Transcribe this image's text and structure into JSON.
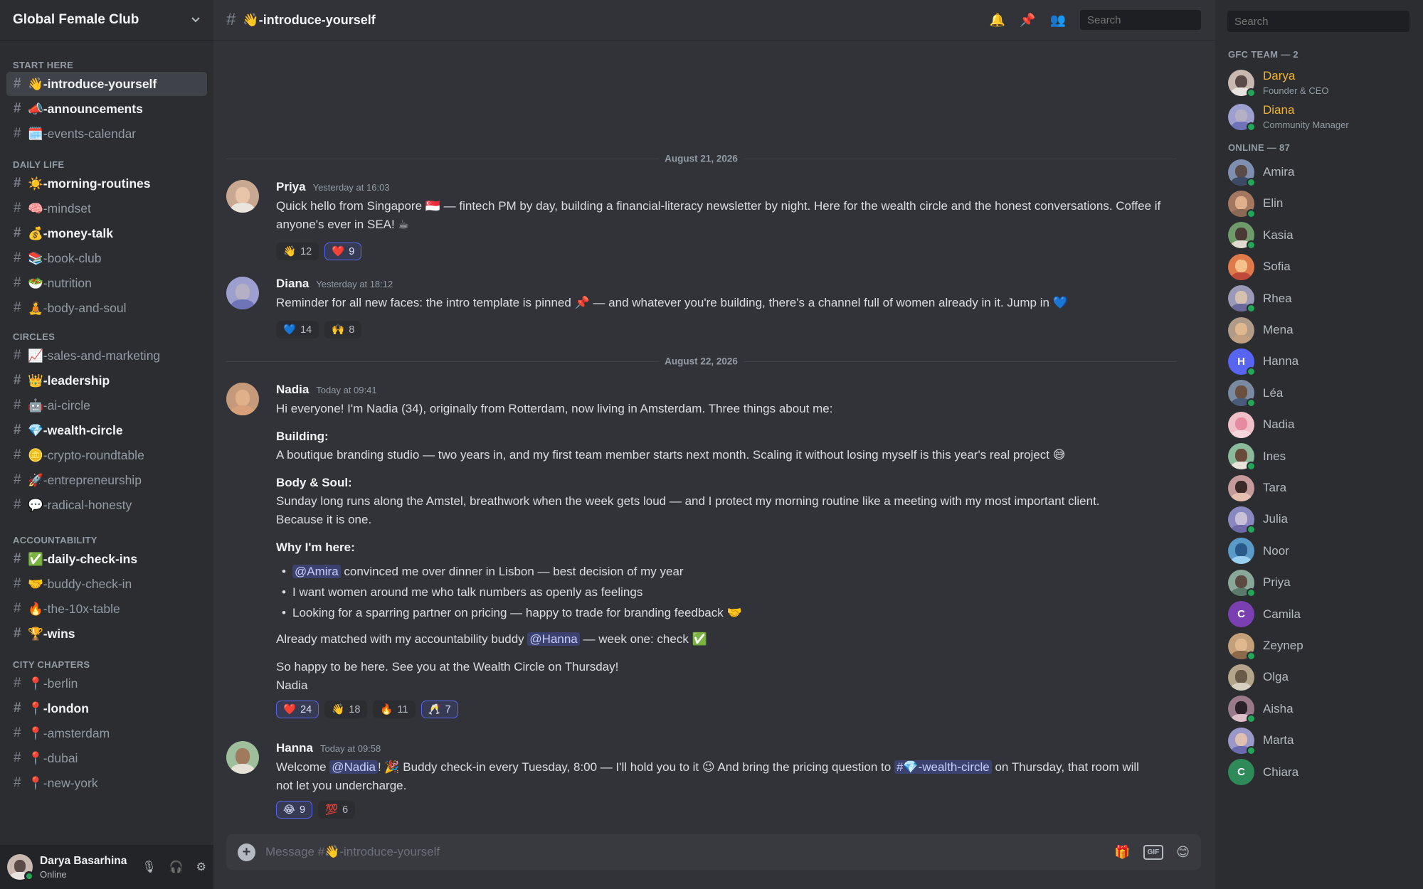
{
  "server": {
    "name": "Global Female Club"
  },
  "categories": [
    {
      "label": "START HERE",
      "channels": [
        {
          "name": "👋-introduce-yourself",
          "state": "active"
        },
        {
          "name": "📣-announcements",
          "state": "unread"
        },
        {
          "name": "🗓️-events-calendar",
          "state": "read"
        }
      ]
    },
    {
      "label": "DAILY LIFE",
      "channels": [
        {
          "name": "☀️-morning-routines",
          "state": "unread"
        },
        {
          "name": "🧠-mindset",
          "state": "read"
        },
        {
          "name": "💰-money-talk",
          "state": "unread"
        },
        {
          "name": "📚-book-club",
          "state": "read"
        },
        {
          "name": "🥗-nutrition",
          "state": "read"
        },
        {
          "name": "🧘-body-and-soul",
          "state": "read"
        }
      ]
    },
    {
      "label": "CIRCLES",
      "channels": [
        {
          "name": "📈-sales-and-marketing",
          "state": "read"
        },
        {
          "name": "👑-leadership",
          "state": "unread"
        },
        {
          "name": "🤖-ai-circle",
          "state": "read"
        },
        {
          "name": "💎-wealth-circle",
          "state": "unread"
        },
        {
          "name": "🪙-crypto-roundtable",
          "state": "read"
        },
        {
          "name": "🚀-entrepreneurship",
          "state": "read"
        },
        {
          "name": "💬-radical-honesty",
          "state": "read"
        }
      ]
    },
    {
      "label": "ACCOUNTABILITY",
      "channels": [
        {
          "name": "✅-daily-check-ins",
          "state": "unread"
        },
        {
          "name": "🤝-buddy-check-in",
          "state": "read"
        },
        {
          "name": "🔥-the-10x-table",
          "state": "read"
        },
        {
          "name": "🏆-wins",
          "state": "unread"
        }
      ]
    },
    {
      "label": "CITY CHAPTERS",
      "channels": [
        {
          "name": "📍-berlin",
          "state": "read"
        },
        {
          "name": "📍-london",
          "state": "unread"
        },
        {
          "name": "📍-amsterdam",
          "state": "read"
        },
        {
          "name": "📍-dubai",
          "state": "read"
        },
        {
          "name": "📍-new-york",
          "state": "read"
        }
      ]
    }
  ],
  "user_panel": {
    "name": "Darya Basarhina",
    "status": "Online"
  },
  "channel_header": {
    "title": "👋-introduce-yourself",
    "search_placeholder": "Search"
  },
  "dividers": [
    "August 21, 2026",
    "August 22, 2026"
  ],
  "messages": [
    {
      "author": "Priya",
      "time": "Yesterday at 16:03",
      "text": "Quick hello from Singapore 🇸🇬 — fintech PM by day, building a financial-literacy newsletter by night. Here for the wealth circle and the honest conversations. Coffee if anyone's ever in SEA! ☕",
      "reactions": [
        {
          "emoji": "👋",
          "count": "12",
          "mine": false
        },
        {
          "emoji": "❤️",
          "count": "9",
          "mine": true
        }
      ]
    },
    {
      "author": "Diana",
      "time": "Yesterday at 18:12",
      "text": "Reminder for all new faces: the intro template is pinned 📌 — and whatever you're building, there's a channel full of women already in it. Jump in 💙",
      "reactions": [
        {
          "emoji": "💙",
          "count": "14",
          "mine": false
        },
        {
          "emoji": "🙌",
          "count": "8",
          "mine": false
        }
      ]
    },
    {
      "author": "Nadia",
      "time": "Today at 09:41",
      "intro": "Hi everyone! I'm Nadia (34), originally from Rotterdam, now living in Amsterdam. Three things about me:",
      "building_label": "Building:",
      "building_text": "A boutique branding studio — two years in, and my first team member starts next month. Scaling it without losing myself is this year's real project 😅",
      "body_label": "Body & Soul:",
      "body_text": "Sunday long runs along the Amstel, breathwork when the week gets loud — and I protect my morning routine like a meeting with my most important client.",
      "body_text2": "Because it is one.",
      "why_label": "Why I'm here:",
      "bullet1_mention": "@Amira",
      "bullet1_text": " convinced me over dinner in Lisbon — best decision of my year",
      "bullet2_text": "I want women around me who talk numbers as openly as feelings",
      "bullet3_text": "Looking for a sparring partner on pricing — happy to trade for branding feedback 🤝",
      "matched_pre": "Already matched with my accountability buddy ",
      "matched_mention": "@Hanna",
      "matched_post": " — week one: check ✅",
      "closing": "So happy to be here. See you at the Wealth Circle on Thursday!",
      "signoff": "Nadia",
      "reactions": [
        {
          "emoji": "❤️",
          "count": "24",
          "mine": true
        },
        {
          "emoji": "👋",
          "count": "18",
          "mine": false
        },
        {
          "emoji": "🔥",
          "count": "11",
          "mine": false
        },
        {
          "emoji": "🥂",
          "count": "7",
          "mine": true
        }
      ]
    },
    {
      "author": "Hanna",
      "time": "Today at 09:58",
      "pre": "Welcome ",
      "mention": "@Nadia",
      "mid": "! 🎉 Buddy check-in every Tuesday, 8:00 — I'll hold you to it 😉 And bring the pricing question to ",
      "channel_mention": "#💎-wealth-circle",
      "post": " on Thursday, that room will",
      "line2": "not let you undercharge.",
      "reactions": [
        {
          "emoji": "😂",
          "count": "9",
          "mine": true
        },
        {
          "emoji": "💯",
          "count": "6",
          "mine": false
        }
      ]
    }
  ],
  "composer": {
    "placeholder": "Message #👋-introduce-yourself",
    "gif_label": "GIF"
  },
  "members": {
    "search_placeholder": "Search",
    "staff_label": "GFC TEAM — 2",
    "staff": [
      {
        "name": "Darya",
        "role": "Founder & CEO"
      },
      {
        "name": "Diana",
        "role": "Community Manager"
      }
    ],
    "online_label": "ONLINE — 87",
    "online": [
      {
        "name": "Amira"
      },
      {
        "name": "Elin"
      },
      {
        "name": "Kasia"
      },
      {
        "name": "Sofia"
      },
      {
        "name": "Rhea"
      },
      {
        "name": "Mena"
      },
      {
        "name": "Hanna",
        "letter": "H"
      },
      {
        "name": "Léa"
      },
      {
        "name": "Nadia"
      },
      {
        "name": "Ines"
      },
      {
        "name": "Tara"
      },
      {
        "name": "Julia"
      },
      {
        "name": "Noor"
      },
      {
        "name": "Priya"
      },
      {
        "name": "Camila",
        "letter": "C"
      },
      {
        "name": "Zeynep"
      },
      {
        "name": "Olga"
      },
      {
        "name": "Aisha"
      },
      {
        "name": "Marta"
      },
      {
        "name": "Chiara",
        "letter": "C"
      }
    ]
  },
  "colors": {
    "accent": "#5865f2",
    "online": "#23a55a",
    "staff_name": "#f0b232",
    "background": "#313338"
  }
}
